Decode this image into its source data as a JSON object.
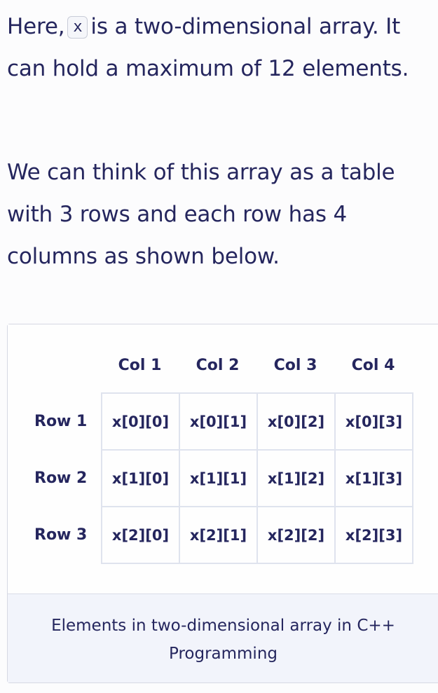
{
  "intro": {
    "prefix": "Here,",
    "code": "x",
    "suffix": "is a two-dimensional array. It can hold a maximum of 12 elements."
  },
  "paragraph2": "We can think of this array as a table with 3 rows and each row has 4 columns as shown below.",
  "figure": {
    "col_headers": [
      "Col 1",
      "Col 2",
      "Col 3",
      "Col 4"
    ],
    "row_headers": [
      "Row 1",
      "Row 2",
      "Row 3"
    ],
    "cells": [
      [
        "x[0][0]",
        "x[0][1]",
        "x[0][2]",
        "x[0][3]"
      ],
      [
        "x[1][0]",
        "x[1][1]",
        "x[1][2]",
        "x[1][3]"
      ],
      [
        "x[2][0]",
        "x[2][1]",
        "x[2][2]",
        "x[2][3]"
      ]
    ],
    "caption": "Elements in two-dimensional array in C++ Programming"
  }
}
